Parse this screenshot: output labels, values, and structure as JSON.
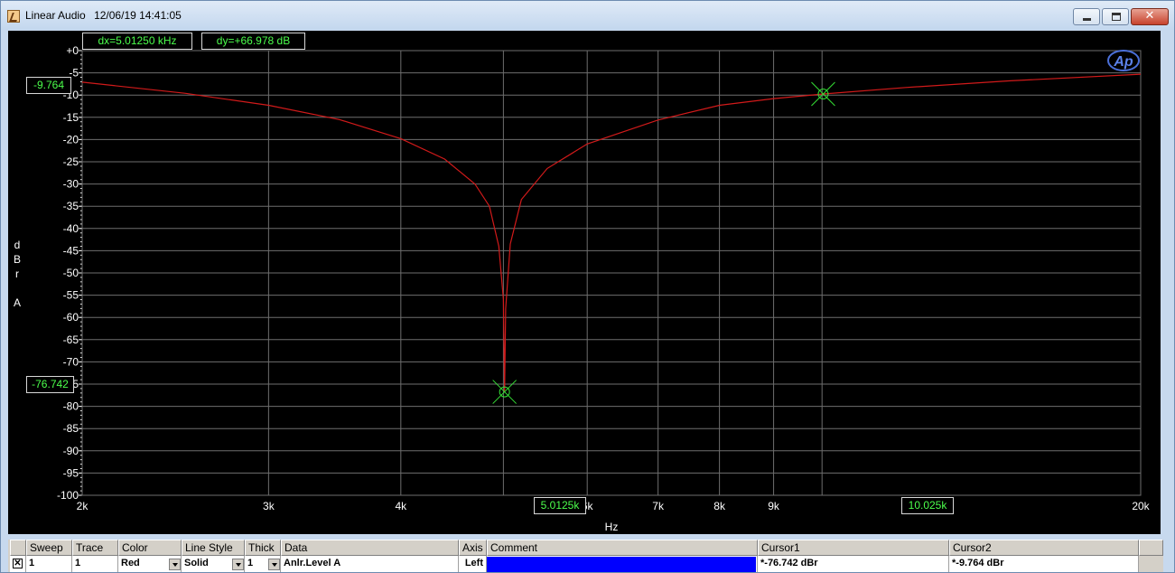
{
  "window": {
    "app_name": "Linear Audio",
    "datetime": "12/06/19 14:41:05",
    "minimize_label": "",
    "maximize_label": "",
    "close_label": "✕"
  },
  "graph": {
    "dx_readout": "dx=5.01250 kHz",
    "dy_readout": "dy=+66.978  dB",
    "cursor1_y_readout": "-9.764",
    "cursor2_y_readout": "-76.742",
    "cursor1_x_readout": "5.0125k",
    "cursor2_x_readout": "10.025k",
    "logo": "Ap",
    "colors": {
      "background": "#000000",
      "grid": "#6e6e6e",
      "trace": "#d11a1a",
      "cursor": "#35e035",
      "axis_text": "#ffffff"
    }
  },
  "chart_data": {
    "type": "line",
    "xlabel": "Hz",
    "ylabel_lines": [
      "d",
      "B",
      "r",
      "",
      "A"
    ],
    "x_scale": "log",
    "xlim": [
      2000,
      20000
    ],
    "ylim": [
      -100,
      0
    ],
    "x_ticks": [
      {
        "value": 2000,
        "label": "2k"
      },
      {
        "value": 3000,
        "label": "3k"
      },
      {
        "value": 4000,
        "label": "4k"
      },
      {
        "value": 6000,
        "label": "6k"
      },
      {
        "value": 7000,
        "label": "7k"
      },
      {
        "value": 8000,
        "label": "8k"
      },
      {
        "value": 9000,
        "label": "9k"
      },
      {
        "value": 20000,
        "label": "20k"
      }
    ],
    "x_gridlines": [
      2000,
      3000,
      4000,
      5000,
      6000,
      7000,
      8000,
      9000,
      10000,
      20000
    ],
    "y_ticks": [
      {
        "value": 0,
        "label": "+0"
      },
      {
        "value": -5,
        "label": "-5"
      },
      {
        "value": -10,
        "label": "-10"
      },
      {
        "value": -15,
        "label": "-15"
      },
      {
        "value": -20,
        "label": "-20"
      },
      {
        "value": -25,
        "label": "-25"
      },
      {
        "value": -30,
        "label": "-30"
      },
      {
        "value": -35,
        "label": "-35"
      },
      {
        "value": -40,
        "label": "-40"
      },
      {
        "value": -45,
        "label": "-45"
      },
      {
        "value": -50,
        "label": "-50"
      },
      {
        "value": -55,
        "label": "-55"
      },
      {
        "value": -60,
        "label": "-60"
      },
      {
        "value": -65,
        "label": "-65"
      },
      {
        "value": -70,
        "label": "-70"
      },
      {
        "value": -75,
        "label": "-75"
      },
      {
        "value": -80,
        "label": "-80"
      },
      {
        "value": -85,
        "label": "-85"
      },
      {
        "value": -90,
        "label": "-90"
      },
      {
        "value": -95,
        "label": "-95"
      },
      {
        "value": -100,
        "label": "-100"
      }
    ],
    "series": [
      {
        "name": "Anlr.Level A",
        "x": [
          2000,
          2500,
          3000,
          3500,
          4000,
          4400,
          4700,
          4850,
          4950,
          5000,
          5012.5,
          5025,
          5075,
          5200,
          5500,
          6000,
          7000,
          8000,
          9000,
          10025,
          12000,
          15000,
          20000
        ],
        "y": [
          -7.1,
          -9.6,
          -12.3,
          -15.5,
          -19.8,
          -24.4,
          -30.0,
          -35.0,
          -44.0,
          -56.0,
          -76.742,
          -58.0,
          -43.5,
          -33.5,
          -26.5,
          -21.0,
          -15.6,
          -12.3,
          -10.8,
          -9.764,
          -8.3,
          -6.8,
          -5.3
        ]
      }
    ],
    "cursors": [
      {
        "x": 5012.5,
        "y": -76.742
      },
      {
        "x": 10025,
        "y": -9.764
      }
    ]
  },
  "table": {
    "headers": {
      "sweep": "Sweep",
      "trace": "Trace",
      "color": "Color",
      "line_style": "Line Style",
      "thick": "Thick",
      "data": "Data",
      "axis": "Axis",
      "comment": "Comment",
      "cursor1": "Cursor1",
      "cursor2": "Cursor2"
    },
    "row": {
      "checked": "✕",
      "sweep": "1",
      "trace": "1",
      "color": "Red",
      "line_style": "Solid",
      "thick": "1",
      "data": "Anlr.Level A",
      "axis": "Left",
      "comment": "",
      "cursor1": "*-76.742  dBr",
      "cursor2": "*-9.764  dBr"
    }
  }
}
